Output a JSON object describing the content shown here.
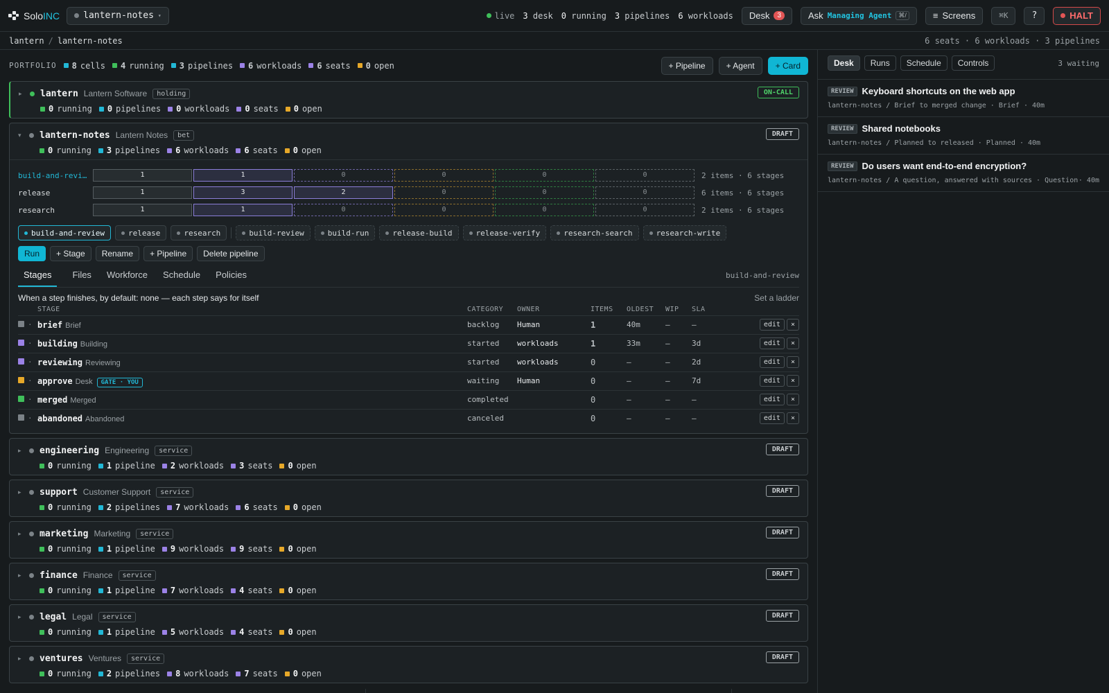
{
  "app": {
    "brand_a": "Solo",
    "brand_b": "INC",
    "project": "lantern-notes"
  },
  "status": {
    "live": "live",
    "desk_n": "3",
    "desk": "desk",
    "running_n": "0",
    "running": "running",
    "pipelines_n": "3",
    "pipelines": "pipelines",
    "workloads_n": "6",
    "workloads": "workloads"
  },
  "toolbar": {
    "desk": "Desk",
    "desk_badge": "3",
    "ask": "Ask",
    "ask_agent": "Managing Agent",
    "ask_kbd": "⌘/",
    "screens": "Screens",
    "cmdk": "⌘K",
    "help": "?",
    "halt": "HALT"
  },
  "breadcrumb": {
    "root": "lantern",
    "sep": "/",
    "current": "lantern-notes",
    "summary": "6 seats · 6 workloads · 3 pipelines"
  },
  "portfolio": {
    "label": "PORTFOLIO",
    "stats": [
      {
        "n": "8",
        "t": "cells"
      },
      {
        "n": "4",
        "t": "running"
      },
      {
        "n": "3",
        "t": "pipelines"
      },
      {
        "n": "6",
        "t": "workloads"
      },
      {
        "n": "6",
        "t": "seats"
      },
      {
        "n": "0",
        "t": "open"
      }
    ],
    "add_pipeline": "+ Pipeline",
    "add_agent": "+ Agent",
    "add_card": "+ Card"
  },
  "cells": [
    {
      "name": "lantern",
      "sub": "Lantern Software",
      "tag": "holding",
      "pill": "ON-CALL",
      "stats": [
        "0",
        "running",
        "0",
        "pipelines",
        "0",
        "workloads",
        "0",
        "seats",
        "0",
        "open"
      ]
    },
    {
      "name": "lantern-notes",
      "sub": "Lantern Notes",
      "tag": "bet",
      "pill": "DRAFT",
      "stats": [
        "0",
        "running",
        "3",
        "pipelines",
        "6",
        "workloads",
        "6",
        "seats",
        "0",
        "open"
      ]
    },
    {
      "name": "engineering",
      "sub": "Engineering",
      "tag": "service",
      "pill": "DRAFT",
      "stats": [
        "0",
        "running",
        "1",
        "pipeline",
        "2",
        "workloads",
        "3",
        "seats",
        "0",
        "open"
      ]
    },
    {
      "name": "support",
      "sub": "Customer Support",
      "tag": "service",
      "pill": "DRAFT",
      "stats": [
        "0",
        "running",
        "2",
        "pipelines",
        "7",
        "workloads",
        "6",
        "seats",
        "0",
        "open"
      ]
    },
    {
      "name": "marketing",
      "sub": "Marketing",
      "tag": "service",
      "pill": "DRAFT",
      "stats": [
        "0",
        "running",
        "1",
        "pipeline",
        "9",
        "workloads",
        "9",
        "seats",
        "0",
        "open"
      ]
    },
    {
      "name": "finance",
      "sub": "Finance",
      "tag": "service",
      "pill": "DRAFT",
      "stats": [
        "0",
        "running",
        "1",
        "pipeline",
        "7",
        "workloads",
        "4",
        "seats",
        "0",
        "open"
      ]
    },
    {
      "name": "legal",
      "sub": "Legal",
      "tag": "service",
      "pill": "DRAFT",
      "stats": [
        "0",
        "running",
        "1",
        "pipeline",
        "5",
        "workloads",
        "4",
        "seats",
        "0",
        "open"
      ]
    },
    {
      "name": "ventures",
      "sub": "Ventures",
      "tag": "service",
      "pill": "DRAFT",
      "stats": [
        "0",
        "running",
        "2",
        "pipelines",
        "8",
        "workloads",
        "7",
        "seats",
        "0",
        "open"
      ]
    }
  ],
  "pipelines": [
    {
      "name": "build-and-revi…",
      "boxes": [
        "1",
        "1",
        "0",
        "0",
        "0",
        "0"
      ],
      "info": "2 items · 6 stages"
    },
    {
      "name": "release",
      "boxes": [
        "1",
        "3",
        "2",
        "0",
        "0",
        "0"
      ],
      "info": "6 items · 6 stages"
    },
    {
      "name": "research",
      "boxes": [
        "1",
        "1",
        "0",
        "0",
        "0",
        "0"
      ],
      "info": "2 items · 6 stages"
    }
  ],
  "pipeline_tabs": [
    "build-and-review",
    "release",
    "research"
  ],
  "workload_tabs": [
    "build-review",
    "build-run",
    "release-build",
    "release-verify",
    "research-search",
    "research-write"
  ],
  "pipeline_actions": {
    "run": "Run",
    "add_stage": "+ Stage",
    "rename": "Rename",
    "add_pipeline": "+ Pipeline",
    "delete": "Delete pipeline"
  },
  "subtabs": {
    "items": [
      "Stages",
      "Files",
      "Workforce",
      "Schedule",
      "Policies"
    ],
    "current": "build-and-review"
  },
  "ladder": {
    "text": "When a step finishes, by default:  none — each step says for itself",
    "action": "Set a ladder"
  },
  "stage_headers": [
    "STAGE",
    "CATEGORY",
    "OWNER",
    "ITEMS",
    "OLDEST",
    "WIP",
    "SLA"
  ],
  "stages": [
    {
      "id": "brief",
      "label": "Brief",
      "cat": "backlog",
      "owner": "Human",
      "items": "1",
      "oldest": "40m",
      "wip": "—",
      "sla": "—",
      "color": "#7b8287"
    },
    {
      "id": "building",
      "label": "Building",
      "cat": "started",
      "owner": "workloads",
      "items": "1",
      "oldest": "33m",
      "wip": "—",
      "sla": "3d",
      "color": "#9b82e6"
    },
    {
      "id": "reviewing",
      "label": "Reviewing",
      "cat": "started",
      "owner": "workloads",
      "items": "0",
      "oldest": "—",
      "wip": "—",
      "sla": "2d",
      "color": "#9b82e6"
    },
    {
      "id": "approve",
      "label": "Desk",
      "gate": "GATE · YOU",
      "cat": "waiting",
      "owner": "Human",
      "items": "0",
      "oldest": "—",
      "wip": "—",
      "sla": "7d",
      "color": "#e6a829"
    },
    {
      "id": "merged",
      "label": "Merged",
      "cat": "completed",
      "owner": "",
      "items": "0",
      "oldest": "—",
      "wip": "—",
      "sla": "—",
      "color": "#3fbf5a"
    },
    {
      "id": "abandoned",
      "label": "Abandoned",
      "cat": "canceled",
      "owner": "",
      "items": "0",
      "oldest": "—",
      "wip": "—",
      "sla": "—",
      "color": "#7b8287"
    }
  ],
  "row_actions": {
    "edit": "edit",
    "remove": "×"
  },
  "right": {
    "tabs": [
      "Desk",
      "Runs",
      "Schedule",
      "Controls"
    ],
    "waiting": "3 waiting",
    "items": [
      {
        "badge": "REVIEW",
        "title": "Keyboard shortcuts on the web app",
        "meta": "lantern-notes / Brief to merged change · Brief · 40m",
        "age": ""
      },
      {
        "badge": "REVIEW",
        "title": "Shared notebooks",
        "meta": "lantern-notes / Planned to released · Planned · 40m",
        "age": ""
      },
      {
        "badge": "REVIEW",
        "title": "Do users want end-to-end encryption?",
        "meta": "lantern-notes / A question, answered with sources · Question",
        "age": "· 40m"
      }
    ]
  }
}
